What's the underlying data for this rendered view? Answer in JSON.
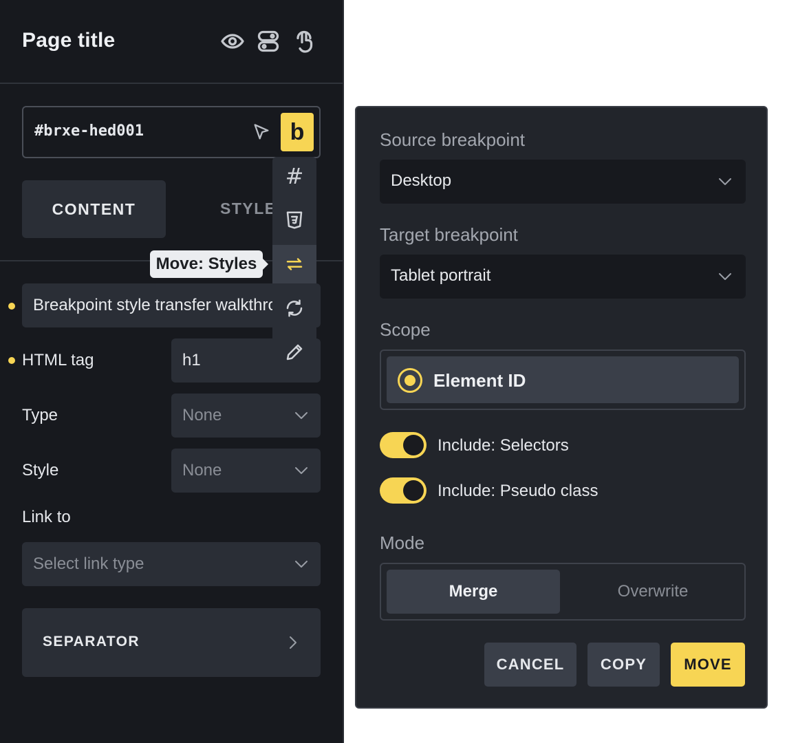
{
  "header": {
    "title": "Page title",
    "icons": [
      "eye-icon",
      "toggles-icon",
      "pointer-hand-icon"
    ]
  },
  "element": {
    "id": "#brxe-hed001",
    "badge": "b"
  },
  "tabs": {
    "content": "CONTENT",
    "style": "STYLE"
  },
  "controls": {
    "text_value": "Breakpoint style transfer walkthrough",
    "html_tag_label": "HTML tag",
    "html_tag_value": "h1",
    "type_label": "Type",
    "type_value": "None",
    "style_label": "Style",
    "style_value": "None",
    "link_label": "Link to",
    "link_placeholder": "Select link type",
    "separator_label": "SEPARATOR"
  },
  "icon_menu": {
    "items": [
      "hash-icon",
      "css3-icon",
      "move-arrows-icon",
      "sync-icon",
      "pencil-icon"
    ],
    "hash_glyph": "#",
    "active_index": 2,
    "tooltip": "Move: Styles"
  },
  "popup": {
    "source_label": "Source breakpoint",
    "source_value": "Desktop",
    "target_label": "Target breakpoint",
    "target_value": "Tablet portrait",
    "scope_label": "Scope",
    "scope_option": "Element ID",
    "toggle_selectors": "Include: Selectors",
    "toggle_pseudo": "Include: Pseudo class",
    "mode_label": "Mode",
    "mode_merge": "Merge",
    "mode_overwrite": "Overwrite",
    "cancel": "CANCEL",
    "copy": "COPY",
    "move": "MOVE"
  },
  "colors": {
    "accent": "#f7d554",
    "panel_bg": "#17191e",
    "popup_bg": "#22252b",
    "control_bg": "#2a2e36"
  }
}
